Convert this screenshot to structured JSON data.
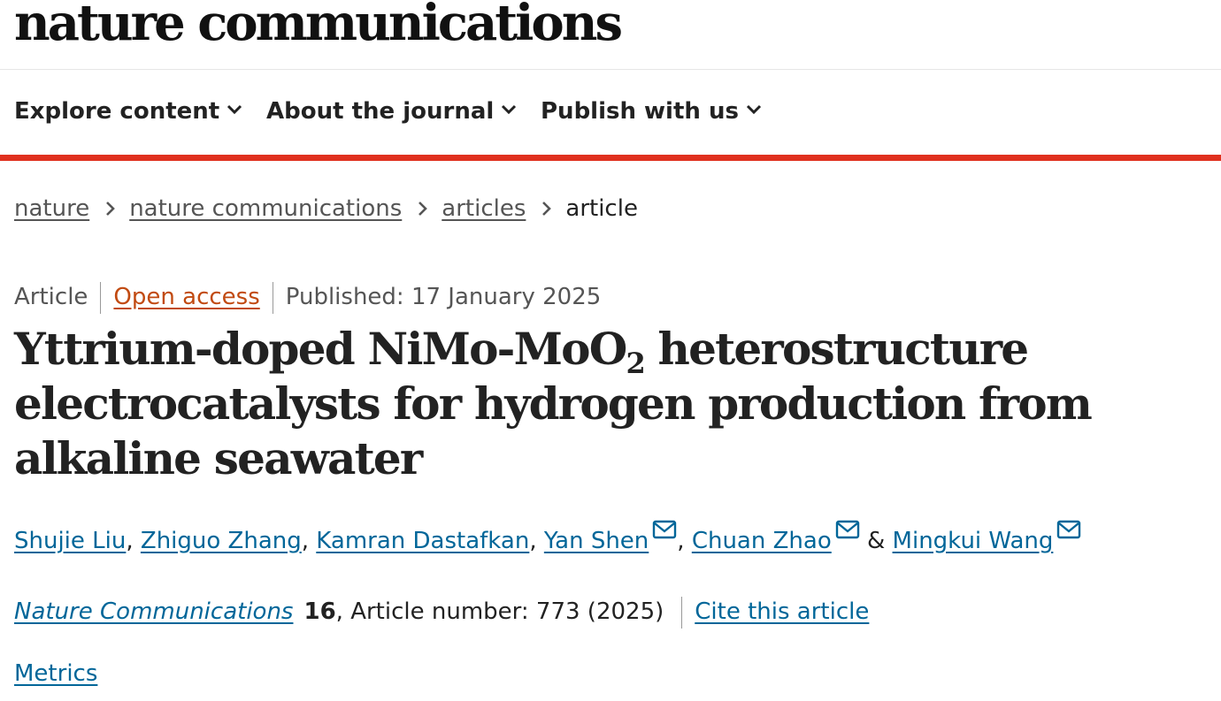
{
  "masthead": {
    "logo_text": "nature communications"
  },
  "nav": {
    "items": [
      {
        "label": "Explore content"
      },
      {
        "label": "About the journal"
      },
      {
        "label": "Publish with us"
      }
    ]
  },
  "colors": {
    "accent_red": "#e0301e",
    "link_blue": "#006699",
    "open_access_orange": "#c14a11"
  },
  "breadcrumb": {
    "items": [
      {
        "label": "nature"
      },
      {
        "label": "nature communications"
      },
      {
        "label": "articles"
      }
    ],
    "current": "article"
  },
  "article": {
    "type": "Article",
    "access": "Open access",
    "published": "Published: 17 January 2025",
    "title": {
      "part1": "Yttrium-doped NiMo-MoO",
      "subscript": "2",
      "part2": " heterostructure electrocatalysts for hydrogen production from alkaline seawater"
    },
    "authors": [
      {
        "name": "Shujie Liu",
        "sep": ", "
      },
      {
        "name": "Zhiguo Zhang",
        "sep": ", "
      },
      {
        "name": "Kamran Dastafkan",
        "sep": ", "
      },
      {
        "name": "Yan Shen",
        "sep": ", "
      },
      {
        "name": "Chuan Zhao",
        "sep": " & "
      },
      {
        "name": "Mingkui Wang",
        "sep": ""
      }
    ],
    "citation": {
      "journal": "Nature Communications",
      "volume": "16",
      "article_number": ", Article number: 773 (2025)",
      "cite_label": "Cite this article"
    },
    "metrics_label": "Metrics"
  }
}
